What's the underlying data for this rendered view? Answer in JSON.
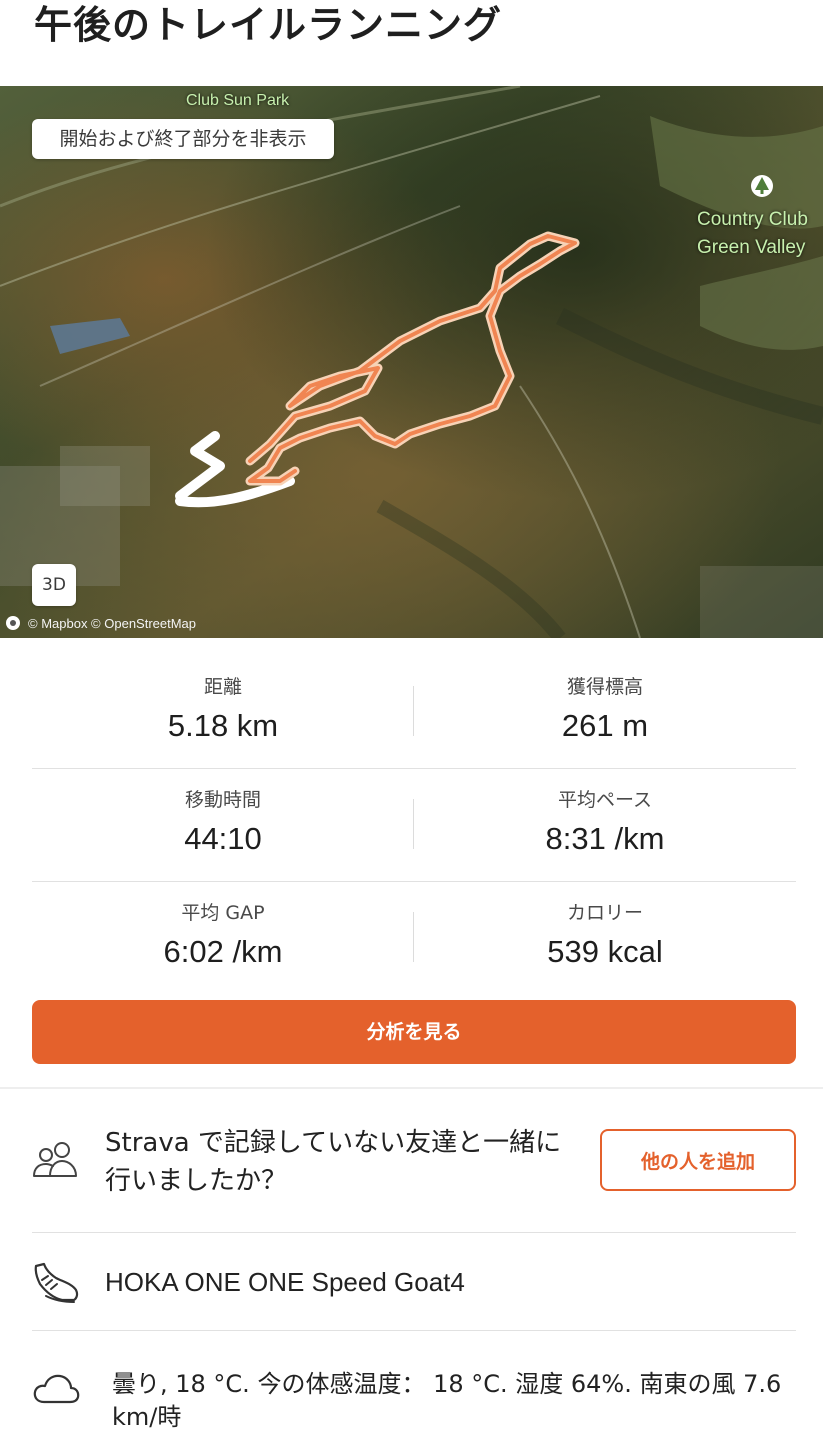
{
  "header": {
    "title": "午後のトレイルランニング"
  },
  "map": {
    "toggle_label": "開始および終了部分を非表示",
    "view_3d_label": "3D",
    "attribution": "© Mapbox © OpenStreetMap",
    "labels": {
      "park": "Club Sun Park",
      "club_line1": "Country Club",
      "club_line2": "Green Valley"
    },
    "route_color": "#f08552"
  },
  "stats": [
    {
      "label": "距離",
      "value": "5.18 km"
    },
    {
      "label": "獲得標高",
      "value": "261 m"
    },
    {
      "label": "移動時間",
      "value": "44:10"
    },
    {
      "label": "平均ペース",
      "value": "8:31 /km"
    },
    {
      "label": "平均 GAP",
      "value": "6:02 /km"
    },
    {
      "label": "カロリー",
      "value": "539 kcal"
    }
  ],
  "actions": {
    "analyze_label": "分析を見る",
    "add_people_label": "他の人を追加"
  },
  "friends_prompt": "Strava で記録していない友達と一緒に行いましたか？",
  "gear": {
    "shoe_name": "HOKA ONE ONE Speed Goat4",
    "icon": "shoe-icon"
  },
  "weather": {
    "text": "曇り, 18 °C. 今の体感温度： 18 °C. 湿度 64%. 南東の風 7.6 km/時",
    "icon": "cloud-icon"
  },
  "colors": {
    "accent": "#e4612c",
    "text": "#1f1f1f",
    "divider": "#e1e1e1"
  }
}
